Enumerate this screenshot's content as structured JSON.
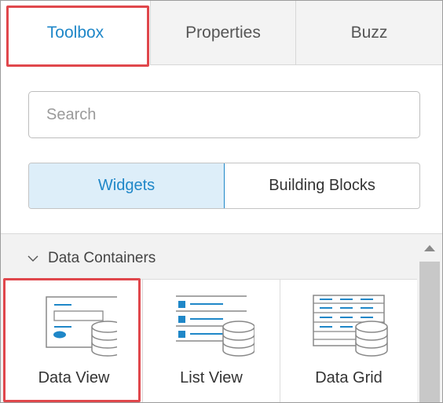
{
  "tabs": [
    {
      "label": "Toolbox",
      "active": true
    },
    {
      "label": "Properties",
      "active": false
    },
    {
      "label": "Buzz",
      "active": false
    }
  ],
  "search": {
    "placeholder": "Search",
    "value": ""
  },
  "view_toggle": {
    "options": [
      "Widgets",
      "Building Blocks"
    ],
    "selected": "Widgets"
  },
  "group": {
    "label": "Data Containers",
    "icon": "chevron-down-icon",
    "expanded": true
  },
  "widgets": [
    {
      "label": "Data View",
      "icon": "data-view-icon"
    },
    {
      "label": "List View",
      "icon": "list-view-icon"
    },
    {
      "label": "Data Grid",
      "icon": "data-grid-icon"
    }
  ],
  "colors": {
    "accent": "#1f87c8",
    "highlight": "#e0474c",
    "active_bg": "#ddeef9",
    "panel_bg": "#f2f2f2"
  }
}
